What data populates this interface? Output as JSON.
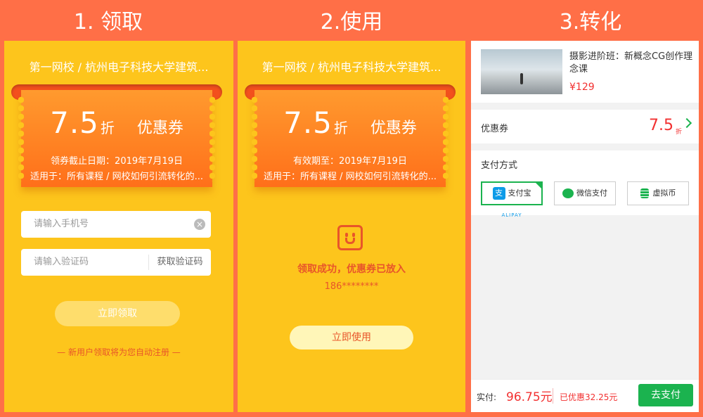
{
  "steps": [
    {
      "title": "1. 领取"
    },
    {
      "title": "2.使用"
    },
    {
      "title": "3.转化"
    }
  ],
  "panel1": {
    "school": "第一网校 / 杭州电子科技大学建筑...",
    "coupon": {
      "value": "7.5",
      "unit": "折",
      "label": "优惠券",
      "line1": "领券截止日期：2019年7月19日",
      "line2": "适用于：所有课程 / 网校如何引流转化的..."
    },
    "phone_placeholder": "请输入手机号",
    "code_placeholder": "请输入验证码",
    "get_code": "获取验证码",
    "claim_button": "立即领取",
    "note": "— 新用户领取将为您自动注册 —"
  },
  "panel2": {
    "school": "第一网校 / 杭州电子科技大学建筑...",
    "coupon": {
      "value": "7.5",
      "unit": "折",
      "label": "优惠券",
      "line1": "有效期至：2019年7月19日",
      "line2": "适用于：所有课程 / 网校如何引流转化的..."
    },
    "success": "领取成功，优惠券已放入",
    "phone": "186********",
    "use_button": "立即使用"
  },
  "panel3": {
    "course_title": "摄影进阶班：新概念CG创作理念课",
    "price": "¥129",
    "coupon_label": "优惠券",
    "coupon_value": "7.5",
    "coupon_unit": "折",
    "pay_method_label": "支付方式",
    "pay_options": [
      "支付宝",
      "微信支付",
      "虚拟币"
    ],
    "alipay_sub": "ALIPAY",
    "actual_label": "实付:",
    "total": "96.75元",
    "saved": "已优惠32.25元",
    "pay_button": "去支付"
  },
  "colors": {
    "background": "#FF6F47",
    "panel": "#FDC51C",
    "accent": "#F23030",
    "green": "#1BB34F"
  }
}
